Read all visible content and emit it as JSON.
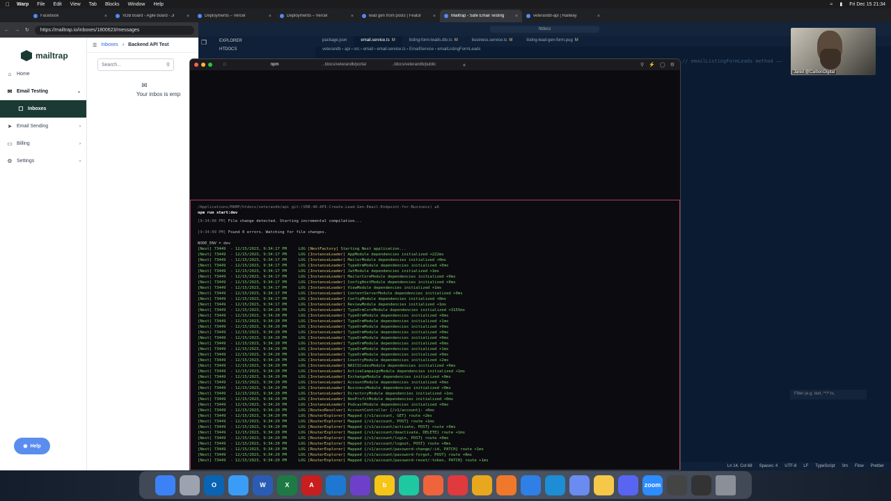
{
  "menubar": {
    "app": "Warp",
    "items": [
      "File",
      "Edit",
      "View",
      "Tab",
      "Blocks",
      "Window",
      "Help"
    ],
    "datetime": "Fri Dec 15  21:34"
  },
  "browser": {
    "tabs": [
      {
        "title": "Facebook",
        "active": false
      },
      {
        "title": "VDB board - Agile board - Ji",
        "active": false
      },
      {
        "title": "Deployments – Vercel",
        "active": false
      },
      {
        "title": "Deployments – Vercel",
        "active": false
      },
      {
        "title": "lead gen from posts | Featur",
        "active": false
      },
      {
        "title": "Mailtrap - Safe Email Testing",
        "active": true
      },
      {
        "title": "veterandb-api | Railway",
        "active": false
      }
    ],
    "url": "https://mailtrap.io/inboxes/1800623/messages"
  },
  "mailtrap": {
    "logo": "mailtrap",
    "nav": [
      {
        "label": "Home",
        "icon": "home-icon"
      },
      {
        "label": "Email Testing",
        "icon": "email-testing-icon"
      },
      {
        "label": "Inboxes",
        "icon": "inbox-icon"
      },
      {
        "label": "Email Sending",
        "icon": "send-icon"
      },
      {
        "label": "Billing",
        "icon": "billing-icon"
      },
      {
        "label": "Settings",
        "icon": "settings-icon"
      }
    ],
    "help": "Help",
    "breadcrumb": {
      "parent": "Inboxes",
      "current": "Backend API Test"
    },
    "search_placeholder": "Search...",
    "empty_message": "Your inbox is emp"
  },
  "vscode": {
    "search": "htdocs",
    "explorer_title": "EXPLORER",
    "explorer_folder": "HTDOCS",
    "tabs": [
      {
        "name": "package.json",
        "mod": ""
      },
      {
        "name": "email.service.ts",
        "mod": "M"
      },
      {
        "name": "listing-form-leads.dto.ts",
        "mod": "M"
      },
      {
        "name": "business.service.ts",
        "mod": "M"
      },
      {
        "name": "listing-lead-gen-form.pug",
        "mod": "M"
      }
    ],
    "breadcrumb": "veterandb › api › src › email › email.service.ts › EmailService › emailListingFormLeads",
    "filter_placeholder": "Filter (e.g. text, **/*.ts,",
    "status": [
      "Ln 14, Col 68",
      "Spaces: 4",
      "UTF-8",
      "LF",
      "TypeScript",
      "0m",
      "Flow",
      "Prettier"
    ]
  },
  "webcam": {
    "name": "Jared @CarbonDigital"
  },
  "warp": {
    "tabs": [
      "npm",
      "..tdocs/veterandb/portal",
      "..tdocs/veterandb/public"
    ],
    "prompt_path": "/Applications/MAMP/htdocs/veterandb/api git:(VDB-40-API-Create-Lead-Gen-Email-Endpoint-for-Business) ±6",
    "command": "npm run start:dev",
    "pre_lines": [
      {
        "ts": "[9:34:08 PM]",
        "text": " File change detected. Starting incremental compilation..."
      },
      {
        "ts": "[9:34:09 PM]",
        "text": " Found 0 errors. Watching for file changes."
      }
    ],
    "node_env": "NODE_ENV = dev",
    "logs": [
      {
        "time": "9:34:17",
        "tag": "[NestFactory]",
        "msg": "Starting Nest application..."
      },
      {
        "time": "9:34:17",
        "tag": "[InstanceLoader]",
        "msg": "AppModule dependencies initialized +222ms"
      },
      {
        "time": "9:34:17",
        "tag": "[InstanceLoader]",
        "msg": "MailerModule dependencies initialized +0ms"
      },
      {
        "time": "9:34:17",
        "tag": "[InstanceLoader]",
        "msg": "TypeOrmModule dependencies initialized +0ms"
      },
      {
        "time": "9:34:17",
        "tag": "[InstanceLoader]",
        "msg": "JwtModule dependencies initialized +1ms"
      },
      {
        "time": "9:34:17",
        "tag": "[InstanceLoader]",
        "msg": "MailerCoreModule dependencies initialized +0ms"
      },
      {
        "time": "9:34:17",
        "tag": "[InstanceLoader]",
        "msg": "ConfigHostModule dependencies initialized +0ms"
      },
      {
        "time": "9:34:17",
        "tag": "[InstanceLoader]",
        "msg": "ViewModule dependencies initialized +1ms"
      },
      {
        "time": "9:34:17",
        "tag": "[InstanceLoader]",
        "msg": "ContentServerModule dependencies initialized +0ms"
      },
      {
        "time": "9:34:17",
        "tag": "[InstanceLoader]",
        "msg": "ConfigModule dependencies initialized +0ms"
      },
      {
        "time": "9:34:17",
        "tag": "[InstanceLoader]",
        "msg": "ReviewModule dependencies initialized +1ms"
      },
      {
        "time": "9:34:20",
        "tag": "[InstanceLoader]",
        "msg": "TypeOrmCoreModule dependencies initialized +3155ms"
      },
      {
        "time": "9:34:20",
        "tag": "[InstanceLoader]",
        "msg": "TypeOrmModule dependencies initialized +0ms"
      },
      {
        "time": "9:34:20",
        "tag": "[InstanceLoader]",
        "msg": "TypeOrmModule dependencies initialized +1ms"
      },
      {
        "time": "9:34:20",
        "tag": "[InstanceLoader]",
        "msg": "TypeOrmModule dependencies initialized +0ms"
      },
      {
        "time": "9:34:20",
        "tag": "[InstanceLoader]",
        "msg": "TypeOrmModule dependencies initialized +0ms"
      },
      {
        "time": "9:34:20",
        "tag": "[InstanceLoader]",
        "msg": "TypeOrmModule dependencies initialized +0ms"
      },
      {
        "time": "9:34:20",
        "tag": "[InstanceLoader]",
        "msg": "TypeOrmModule dependencies initialized +0ms"
      },
      {
        "time": "9:34:20",
        "tag": "[InstanceLoader]",
        "msg": "TypeOrmModule dependencies initialized +1ms"
      },
      {
        "time": "9:34:20",
        "tag": "[InstanceLoader]",
        "msg": "TypeOrmModule dependencies initialized +0ms"
      },
      {
        "time": "9:34:20",
        "tag": "[InstanceLoader]",
        "msg": "CountryModule dependencies initialized +2ms"
      },
      {
        "time": "9:34:20",
        "tag": "[InstanceLoader]",
        "msg": "NAICSCodesModule dependencies initialized +0ms"
      },
      {
        "time": "9:34:20",
        "tag": "[InstanceLoader]",
        "msg": "ActiveCampaignModule dependencies initialized +1ms"
      },
      {
        "time": "9:34:20",
        "tag": "[InstanceLoader]",
        "msg": "ExchangeModule dependencies initialized +0ms"
      },
      {
        "time": "9:34:20",
        "tag": "[InstanceLoader]",
        "msg": "AccountModule dependencies initialized +0ms"
      },
      {
        "time": "9:34:20",
        "tag": "[InstanceLoader]",
        "msg": "BusinessModule dependencies initialized +0ms"
      },
      {
        "time": "9:34:20",
        "tag": "[InstanceLoader]",
        "msg": "DirectoryModule dependencies initialized +1ms"
      },
      {
        "time": "9:34:20",
        "tag": "[InstanceLoader]",
        "msg": "NonProfitModule dependencies initialized +0ms"
      },
      {
        "time": "9:34:20",
        "tag": "[InstanceLoader]",
        "msg": "PodcastModule dependencies initialized +0ms"
      },
      {
        "time": "9:34:20",
        "tag": "[RoutesResolver]",
        "msg": "AccountController {/v1/account}: +6ms"
      },
      {
        "time": "9:34:20",
        "tag": "[RouterExplorer]",
        "msg": "Mapped {/v1/account, GET} route +2ms"
      },
      {
        "time": "9:34:20",
        "tag": "[RouterExplorer]",
        "msg": "Mapped {/v1/account, POST} route +1ms"
      },
      {
        "time": "9:34:20",
        "tag": "[RouterExplorer]",
        "msg": "Mapped {/v1/account/activate, POST} route +0ms"
      },
      {
        "time": "9:34:20",
        "tag": "[RouterExplorer]",
        "msg": "Mapped {/v1/account/deactivate, DELETE} route +1ms"
      },
      {
        "time": "9:34:20",
        "tag": "[RouterExplorer]",
        "msg": "Mapped {/v1/account/login, POST} route +0ms"
      },
      {
        "time": "9:34:20",
        "tag": "[RouterExplorer]",
        "msg": "Mapped {/v1/account/logout, POST} route +0ms"
      },
      {
        "time": "9:34:20",
        "tag": "[RouterExplorer]",
        "msg": "Mapped {/v1/account/password-change/:id, PATCH} route +1ms"
      },
      {
        "time": "9:34:20",
        "tag": "[RouterExplorer]",
        "msg": "Mapped {/v1/account/password-forgot, POST} route +0ms"
      },
      {
        "time": "9:34:20",
        "tag": "[RouterExplorer]",
        "msg": "Mapped {/v1/account/password-reset/:token, PATCH} route +1ms"
      }
    ],
    "log_prefix": "[Nest] 73449  - 12/15/2023, ",
    "log_level": "LOG"
  },
  "dock": [
    {
      "name": "finder",
      "label": "",
      "color": "#3b82f6"
    },
    {
      "name": "launchpad",
      "label": "",
      "color": "#9ca3af"
    },
    {
      "name": "outlook",
      "label": "O",
      "color": "#0a64b4"
    },
    {
      "name": "mail",
      "label": "",
      "color": "#3b9cf6"
    },
    {
      "name": "word",
      "label": "W",
      "color": "#2b5cb5"
    },
    {
      "name": "excel",
      "label": "X",
      "color": "#1e7a44"
    },
    {
      "name": "acrobat",
      "label": "A",
      "color": "#c81e1e"
    },
    {
      "name": "vscode",
      "label": "",
      "color": "#1e78d2"
    },
    {
      "name": "github",
      "label": "",
      "color": "#6e40c9"
    },
    {
      "name": "bitwarden",
      "label": "b",
      "color": "#f5c518"
    },
    {
      "name": "warp",
      "label": "",
      "color": "#1ec8a0"
    },
    {
      "name": "editor",
      "label": "",
      "color": "#f0643c"
    },
    {
      "name": "lucid",
      "label": "",
      "color": "#e0393e"
    },
    {
      "name": "chrome",
      "label": "",
      "color": "#e8a81e"
    },
    {
      "name": "firefox",
      "label": "",
      "color": "#f0782a"
    },
    {
      "name": "safari",
      "label": "",
      "color": "#2f7fe6"
    },
    {
      "name": "edge",
      "label": "",
      "color": "#1d8dd6"
    },
    {
      "name": "facetime",
      "label": "",
      "color": "#6a8cf0"
    },
    {
      "name": "notes",
      "label": "",
      "color": "#f5c84a"
    },
    {
      "name": "discord",
      "label": "",
      "color": "#5865f2"
    },
    {
      "name": "zoom",
      "label": "zoom",
      "color": "#2d8cff"
    },
    {
      "name": "chatgpt",
      "label": "",
      "color": "#444"
    },
    {
      "name": "screenshot",
      "label": "",
      "color": "#333"
    },
    {
      "name": "trash",
      "label": "",
      "color": "#8a8f98"
    }
  ]
}
